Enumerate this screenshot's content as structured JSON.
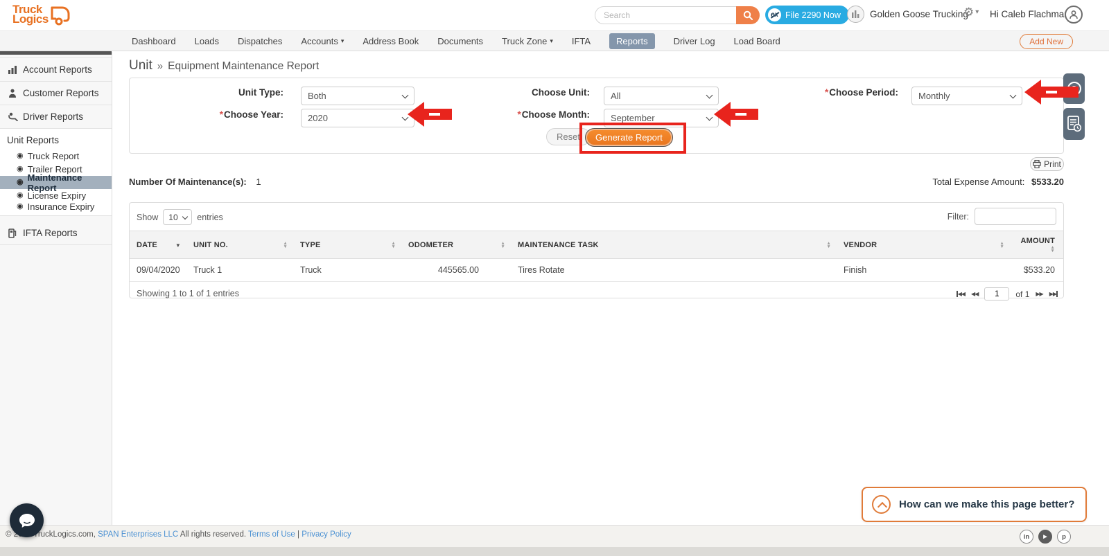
{
  "brand": {
    "logo_line1": "Truck",
    "logo_line2": "Logics"
  },
  "topbar": {
    "search_placeholder": "Search",
    "ex_badge": "ex",
    "file_2290": "File 2290 Now",
    "company": "Golden Goose Trucking",
    "greeting": "Hi Caleb Flachman"
  },
  "nav": {
    "items": [
      "Dashboard",
      "Loads",
      "Dispatches",
      "Accounts",
      "Address Book",
      "Documents",
      "Truck Zone",
      "IFTA",
      "Reports",
      "Driver Log",
      "Load Board"
    ],
    "add_new": "Add New"
  },
  "sidebar": {
    "account_reports": "Account Reports",
    "customer_reports": "Customer Reports",
    "driver_reports": "Driver Reports",
    "unit_reports": "Unit Reports",
    "unit_children": [
      "Truck Report",
      "Trailer Report",
      "Maintenance Report",
      "License Expiry",
      "Insurance Expiry"
    ],
    "ifta_reports": "IFTA Reports"
  },
  "page": {
    "title_main": "Unit",
    "title_sep": "»",
    "title_sub": "Equipment Maintenance Report"
  },
  "filters": {
    "required_marker": "*",
    "unit_type_label": "Unit Type:",
    "unit_type_value": "Both",
    "choose_unit_label": "Choose Unit:",
    "choose_unit_value": "All",
    "choose_period_label": "Choose Period:",
    "choose_period_value": "Monthly",
    "choose_year_label": "Choose Year:",
    "choose_year_value": "2020",
    "choose_month_label": "Choose Month:",
    "choose_month_value": "September",
    "reset": "Reset",
    "generate": "Generate Report"
  },
  "summary": {
    "count_label": "Number Of Maintenance(s):",
    "count_value": "1",
    "total_label": "Total Expense Amount:",
    "total_value": "$533.20",
    "print": "Print"
  },
  "table": {
    "show": "Show",
    "page_size": "10",
    "entries": "entries",
    "filter_label": "Filter:",
    "filter_value": "",
    "columns": [
      "DATE",
      "UNIT NO.",
      "TYPE",
      "ODOMETER",
      "MAINTENANCE TASK",
      "VENDOR",
      "AMOUNT"
    ],
    "rows": [
      [
        "09/04/2020",
        "Truck 1",
        "Truck",
        "445565.00",
        "Tires Rotate",
        "Finish",
        "$533.20"
      ]
    ],
    "info": "Showing 1 to 1 of 1 entries",
    "page_value": "1",
    "page_of": "of 1"
  },
  "feedback": {
    "text": "How can we make this page better?"
  },
  "footer": {
    "copyright": "© 2021 TruckLogics.com,",
    "span_link": "SPAN Enterprises LLC",
    "rights": "All rights reserved.",
    "terms": "Terms of Use",
    "sep": "|",
    "privacy": "Privacy Policy",
    "social": [
      "in",
      "▶",
      "p"
    ]
  },
  "icons": {
    "caret": "▾",
    "gear": "⚙",
    "bullet": "◉",
    "sort_up": "▲",
    "sort_down": "▼",
    "question": "?",
    "prev": "◀◀",
    "next": "▶▶"
  },
  "colors": {
    "brand_orange": "#e87122",
    "annotation_red": "#e8241d",
    "nav_active": "#8496ab",
    "file2290_blue": "#29abe2",
    "link_blue": "#4a90d2"
  }
}
